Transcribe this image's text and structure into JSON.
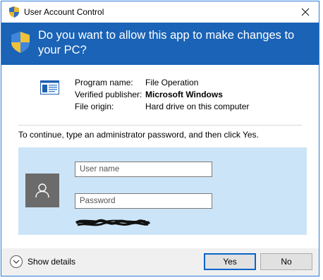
{
  "window": {
    "title": "User Account Control"
  },
  "header": {
    "question": "Do you want to allow this app to make changes to your PC?"
  },
  "program": {
    "name_label": "Program name:",
    "name_value": "File Operation",
    "publisher_label": "Verified publisher:",
    "publisher_value": "Microsoft Windows",
    "origin_label": "File origin:",
    "origin_value": "Hard drive on this computer"
  },
  "credentials": {
    "instruction": "To continue, type an administrator password, and then click Yes.",
    "username_placeholder": "User name",
    "password_placeholder": "Password"
  },
  "footer": {
    "show_details": "Show details",
    "yes_label": "Yes",
    "no_label": "No"
  },
  "colors": {
    "header_bg": "#1a63b6",
    "panel_bg": "#cce4f7",
    "accent": "#0a64c8"
  },
  "icons": {
    "title": "uac-shield-icon",
    "header": "uac-shield-icon",
    "program": "window-app-icon",
    "user": "user-icon",
    "toggle": "chevron-down-icon",
    "close": "close-icon"
  }
}
